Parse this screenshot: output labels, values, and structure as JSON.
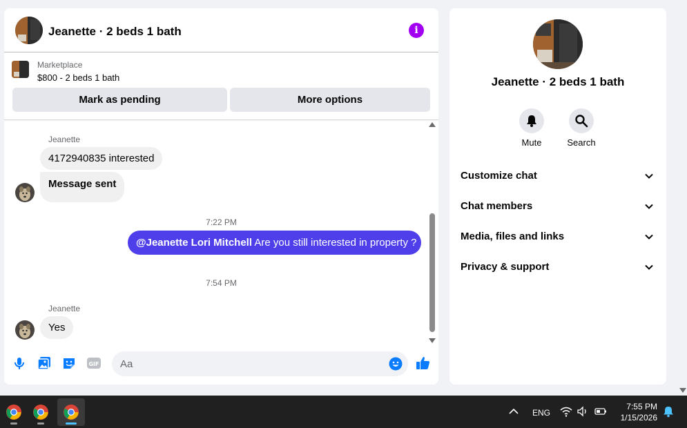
{
  "header": {
    "title": "Jeanette · 2 beds 1 bath"
  },
  "listing": {
    "category": "Marketplace",
    "price_title": "$800 - 2 beds 1 bath",
    "mark_pending_label": "Mark as pending",
    "more_options_label": "More options"
  },
  "messages": {
    "group1_sender": "Jeanette",
    "group1_msg1": "4172940835 interested",
    "group1_msg2": "Message sent",
    "time1": "7:22 PM",
    "outgoing_mention": "@Jeanette Lori Mitchell",
    "outgoing_text": " Are you still interested in property ?",
    "time2": "7:54 PM",
    "group2_sender": "Jeanette",
    "group2_msg1": "Yes"
  },
  "composer": {
    "placeholder": "Aa"
  },
  "info_panel": {
    "name": "Jeanette · 2 beds 1 bath",
    "mute_label": "Mute",
    "search_label": "Search",
    "sections": [
      "Customize chat",
      "Chat members",
      "Media, files and links",
      "Privacy & support"
    ]
  },
  "taskbar": {
    "language": "ENG",
    "time": "7:55 PM",
    "date": "1/15/2026"
  },
  "colors": {
    "accent": "#4e3fea",
    "info_purple": "#a100f2",
    "icon_blue": "#0a7cff"
  }
}
